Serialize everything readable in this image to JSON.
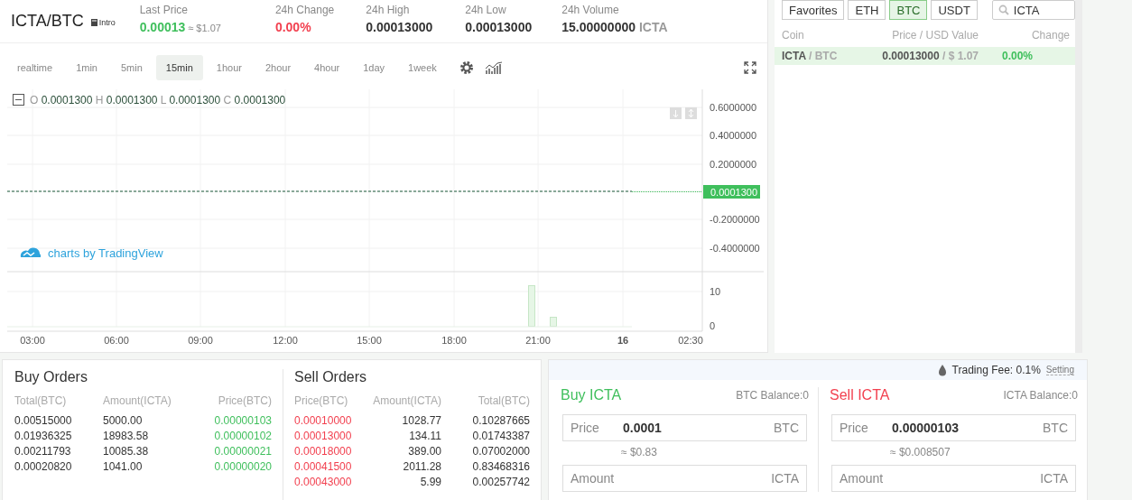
{
  "pair": {
    "title": "ICTA/BTC",
    "intro": "Intro"
  },
  "stats": [
    {
      "label": "Last Price",
      "value": "0.00013",
      "sub": "≈ $1.07",
      "kind": "up"
    },
    {
      "label": "24h Change",
      "value": "0.00%",
      "kind": "down"
    },
    {
      "label": "24h High",
      "value": "0.00013000",
      "kind": "plain"
    },
    {
      "label": "24h Low",
      "value": "0.00013000",
      "kind": "plain"
    },
    {
      "label": "24h Volume",
      "value": "15.00000000",
      "unit": "ICTA",
      "kind": "plain"
    }
  ],
  "intervals": [
    {
      "label": "realtime",
      "selected": false
    },
    {
      "label": "1min",
      "selected": false
    },
    {
      "label": "5min",
      "selected": false
    },
    {
      "label": "15min",
      "selected": true
    },
    {
      "label": "1hour",
      "selected": false
    },
    {
      "label": "2hour",
      "selected": false
    },
    {
      "label": "4hour",
      "selected": false
    },
    {
      "label": "1day",
      "selected": false
    },
    {
      "label": "1week",
      "selected": false
    }
  ],
  "chart": {
    "legend": [
      {
        "key": "O",
        "value": "0.0001300"
      },
      {
        "key": "H",
        "value": "0.0001300"
      },
      {
        "key": "L",
        "value": "0.0001300"
      },
      {
        "key": "C",
        "value": "0.0001300"
      }
    ],
    "price_axis": [
      "0.6000000",
      "0.4000000",
      "0.2000000",
      "-0.2000000",
      "-0.4000000"
    ],
    "last_price_tag": "0.0001300",
    "volume_axis": [
      "10",
      "0"
    ],
    "time_axis": [
      "03:00",
      "06:00",
      "09:00",
      "12:00",
      "15:00",
      "18:00",
      "21:00",
      "16",
      "02:30"
    ],
    "watermark": "charts by TradingView"
  },
  "market": {
    "tabs": [
      {
        "label": "Favorites",
        "selected": false
      },
      {
        "label": "ETH",
        "selected": false
      },
      {
        "label": "BTC",
        "selected": true
      },
      {
        "label": "USDT",
        "selected": false
      }
    ],
    "search": {
      "value": "ICTA"
    },
    "columns": [
      "Coin",
      "Price / USD Value",
      "Change"
    ],
    "rows": [
      {
        "coin": "ICTA",
        "quote": "/ BTC",
        "price": "0.00013000",
        "usd": "/ $ 1.07",
        "change": "0.00%",
        "selected": true
      }
    ]
  },
  "buy_orders": {
    "title": "Buy Orders",
    "columns": [
      "Total(BTC)",
      "Amount(ICTA)",
      "Price(BTC)"
    ],
    "rows": [
      [
        "0.00515000",
        "5000.00",
        "0.00000103"
      ],
      [
        "0.01936325",
        "18983.58",
        "0.00000102"
      ],
      [
        "0.00211793",
        "10085.38",
        "0.00000021"
      ],
      [
        "0.00020820",
        "1041.00",
        "0.00000020"
      ]
    ]
  },
  "sell_orders": {
    "title": "Sell Orders",
    "columns": [
      "Price(BTC)",
      "Amount(ICTA)",
      "Total(BTC)"
    ],
    "rows": [
      [
        "0.00010000",
        "1028.77",
        "0.10287665"
      ],
      [
        "0.00013000",
        "134.11",
        "0.01743387"
      ],
      [
        "0.00018000",
        "389.00",
        "0.07002000"
      ],
      [
        "0.00041500",
        "2011.28",
        "0.83468316"
      ],
      [
        "0.00043000",
        "5.99",
        "0.00257742"
      ]
    ]
  },
  "trade": {
    "fee": "Trading Fee: 0.1%",
    "setting": "Setting",
    "forms": [
      {
        "kind": "buy",
        "title": "Buy ICTA",
        "balance": "BTC Balance:0",
        "price_label": "Price",
        "price": "0.0001",
        "price_unit": "BTC",
        "approx": "≈ $0.83",
        "amount_label": "Amount",
        "amount_unit": "ICTA"
      },
      {
        "kind": "sell",
        "title": "Sell ICTA",
        "balance": "ICTA Balance:0",
        "price_label": "Price",
        "price": "0.00000103",
        "price_unit": "BTC",
        "approx": "≈ $0.008507",
        "amount_label": "Amount",
        "amount_unit": "ICTA"
      }
    ]
  }
}
